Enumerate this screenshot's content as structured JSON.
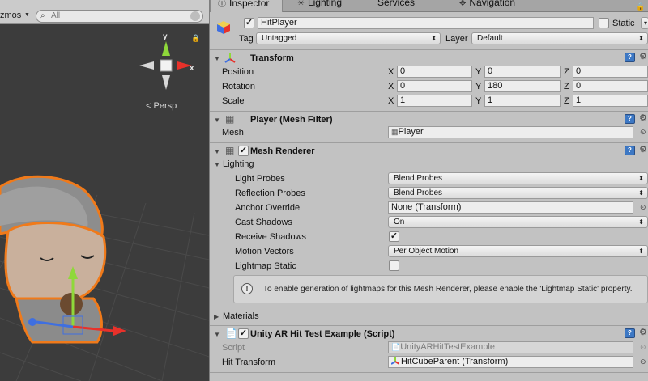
{
  "scene": {
    "gizmos_label": "zmos",
    "search_placeholder": "All",
    "persp_label": "Persp",
    "axis_y": "y",
    "axis_x": "x"
  },
  "tabs": [
    {
      "label": "Inspector",
      "active": true
    },
    {
      "label": "Lighting",
      "active": false
    },
    {
      "label": "Services",
      "active": false
    },
    {
      "label": "Navigation",
      "active": false
    }
  ],
  "object": {
    "name": "HitPlayer",
    "active": true,
    "static_label": "Static",
    "tag_label": "Tag",
    "tag_value": "Untagged",
    "layer_label": "Layer",
    "layer_value": "Default"
  },
  "transform": {
    "title": "Transform",
    "position_label": "Position",
    "rotation_label": "Rotation",
    "scale_label": "Scale",
    "x": "X",
    "y": "Y",
    "z": "Z",
    "position": [
      "0",
      "0",
      "0"
    ],
    "rotation": [
      "0",
      "180",
      "0"
    ],
    "scale": [
      "1",
      "1",
      "1"
    ]
  },
  "mesh_filter": {
    "title": "Player (Mesh Filter)",
    "mesh_label": "Mesh",
    "mesh_value": "Player"
  },
  "mesh_renderer": {
    "title": "Mesh Renderer",
    "lighting_label": "Lighting",
    "light_probes_label": "Light Probes",
    "light_probes_value": "Blend Probes",
    "reflection_probes_label": "Reflection Probes",
    "reflection_probes_value": "Blend Probes",
    "anchor_override_label": "Anchor Override",
    "anchor_override_value": "None (Transform)",
    "cast_shadows_label": "Cast Shadows",
    "cast_shadows_value": "On",
    "receive_shadows_label": "Receive Shadows",
    "motion_vectors_label": "Motion Vectors",
    "motion_vectors_value": "Per Object Motion",
    "lightmap_static_label": "Lightmap Static",
    "help_text": "To enable generation of lightmaps for this Mesh Renderer, please enable the 'Lightmap Static' property.",
    "materials_label": "Materials"
  },
  "script_component": {
    "title": "Unity AR Hit Test Example (Script)",
    "script_label": "Script",
    "script_value": "UnityARHitTestExample",
    "hit_transform_label": "Hit Transform",
    "hit_transform_value": "HitCubeParent (Transform)"
  },
  "icons": {
    "help": "?",
    "gear": "⚙",
    "target": "⊙",
    "lock": "🔒",
    "check": "✓",
    "info": "!"
  },
  "colors": {
    "selection_outline": "#f07a1a",
    "axis_x": "#e8312a",
    "axis_y": "#8fd83a",
    "axis_z": "#3f6fe0",
    "help_icon": "#3d78c4"
  }
}
